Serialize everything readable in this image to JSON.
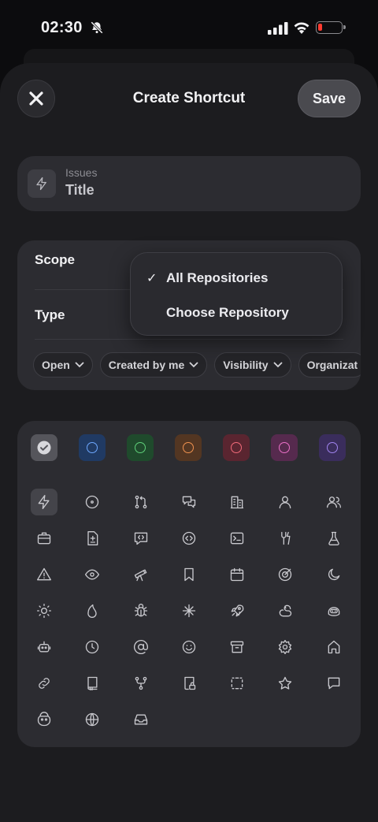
{
  "status_bar": {
    "time": "02:30"
  },
  "header": {
    "title": "Create Shortcut",
    "save_label": "Save",
    "close_icon": "close-icon"
  },
  "title_field": {
    "category": "Issues",
    "value": "Title",
    "icon": "zap-icon"
  },
  "scope_section": {
    "scope_label": "Scope",
    "type_label": "Type",
    "filters": [
      {
        "label": "Open"
      },
      {
        "label": "Created by me"
      },
      {
        "label": "Visibility"
      },
      {
        "label": "Organizat"
      }
    ]
  },
  "scope_menu": {
    "items": [
      {
        "label": "All Repositories",
        "checked": true
      },
      {
        "label": "Choose Repository",
        "checked": false
      }
    ]
  },
  "colors": [
    {
      "name": "gray",
      "bg": "#55555b",
      "ring": "#d8d8dc",
      "selected": true
    },
    {
      "name": "blue",
      "bg": "#203a63",
      "ring": "#6ea8ff"
    },
    {
      "name": "green",
      "bg": "#1f4a2c",
      "ring": "#5fd07a"
    },
    {
      "name": "orange",
      "bg": "#533622",
      "ring": "#f0924f"
    },
    {
      "name": "red",
      "bg": "#5a2530",
      "ring": "#f26b7a"
    },
    {
      "name": "pink",
      "bg": "#562a4e",
      "ring": "#ec70c8"
    },
    {
      "name": "purple",
      "bg": "#3a2d5c",
      "ring": "#a184f0"
    }
  ],
  "icons": [
    "zap-icon",
    "issue-opened-icon",
    "git-pull-request-icon",
    "comment-discussion-icon",
    "organization-icon",
    "person-icon",
    "people-icon",
    "briefcase-icon",
    "file-diff-icon",
    "code-review-icon",
    "code-of-conduct-icon",
    "terminal-icon",
    "tools-icon",
    "beaker-icon",
    "alert-icon",
    "eye-icon",
    "telescope-icon",
    "bookmark-icon",
    "calendar-icon",
    "goal-icon",
    "moon-icon",
    "sun-icon",
    "flame-icon",
    "bug-icon",
    "sparkle-icon",
    "rocket-icon",
    "squirrel-icon",
    "copilot-icon",
    "robot-icon",
    "clock-icon",
    "mention-icon",
    "smiley-icon",
    "archive-icon",
    "gear-icon",
    "home-icon",
    "link-icon",
    "repo-icon",
    "repo-forked-icon",
    "repo-locked-icon",
    "dashed-box-icon",
    "star-icon",
    "comment-icon",
    "mascot-icon",
    "globe-icon",
    "inbox-icon"
  ]
}
